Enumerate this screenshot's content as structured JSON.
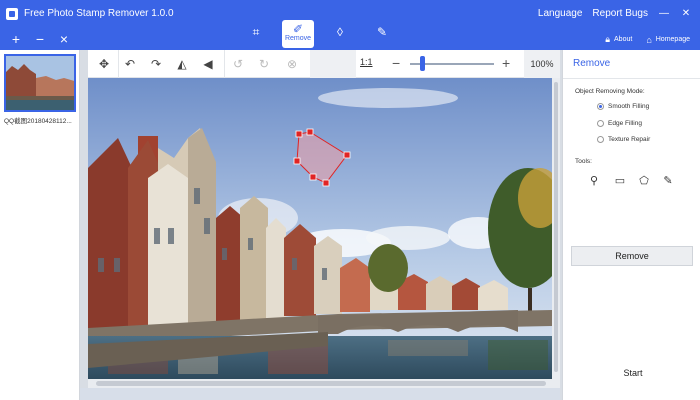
{
  "titlebar": {
    "title": "Free Photo Stamp Remover 1.0.0",
    "language": "Language",
    "report_bugs": "Report Bugs",
    "minimize": "—",
    "close": "✕"
  },
  "modebar": {
    "add": "+",
    "remove": "−",
    "clear": "×",
    "tabs": [
      {
        "icon": "crop-icon",
        "glyph": "⌗"
      },
      {
        "icon": "eraser-icon",
        "glyph": "✐",
        "label": "Remove"
      },
      {
        "icon": "drop-icon",
        "glyph": "◊"
      },
      {
        "icon": "brush-icon",
        "glyph": "✎"
      }
    ],
    "about": "About",
    "homepage": "Homepage"
  },
  "thumbnail": {
    "label": "QQ截图20180428112..."
  },
  "toolbar": {
    "ratio": "1:1",
    "zoom_minus": "−",
    "zoom_plus": "+",
    "zoom": "100%",
    "zoom_level": 0.14
  },
  "right_panel": {
    "title": "Remove",
    "mode_label": "Object Removing Mode:",
    "modes": [
      "Smooth Filling",
      "Edge Filling",
      "Texture Repair"
    ],
    "selected_mode": "Smooth Filling",
    "tools_label": "Tools:",
    "remove_button": "Remove",
    "start_button": "Start"
  },
  "colors": {
    "accent": "#3a64e6",
    "selection_fill": "#e8a0a8",
    "selection_handle": "#e02424"
  }
}
